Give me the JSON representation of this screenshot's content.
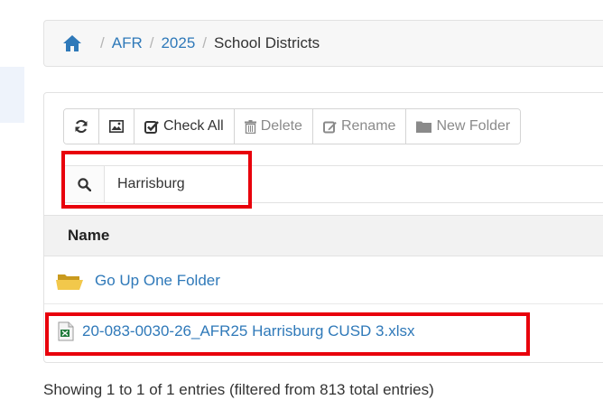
{
  "breadcrumb": {
    "items": [
      {
        "label": "AFR",
        "link": true
      },
      {
        "label": "2025",
        "link": true
      },
      {
        "label": "School Districts",
        "link": false
      }
    ],
    "separator": "/"
  },
  "toolbar": {
    "check_all_label": "Check All",
    "delete_label": "Delete",
    "rename_label": "Rename",
    "new_folder_label": "New Folder"
  },
  "search": {
    "value": "Harrisburg"
  },
  "table": {
    "header": "Name",
    "rows": [
      {
        "icon": "folder-icon",
        "label": "Go Up One Folder"
      },
      {
        "icon": "excel-file-icon",
        "label": "20-083-0030-26_AFR25 Harrisburg CUSD 3.xlsx"
      }
    ]
  },
  "footer": {
    "info": "Showing 1 to 1 of 1 entries (filtered from 813 total entries)"
  },
  "colors": {
    "link": "#2f79b9",
    "highlight": "#e8000b"
  }
}
